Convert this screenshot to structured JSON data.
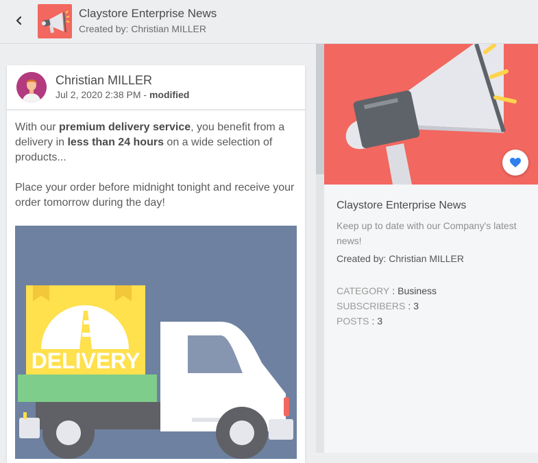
{
  "header": {
    "title": "Claystore Enterprise News",
    "subtitle": "Created by: Christian MILLER",
    "back_icon": "chevron-left-icon",
    "thumb_icon": "megaphone-icon"
  },
  "post": {
    "author": "Christian MILLER",
    "date": "Jul 2, 2020 2:38 PM",
    "date_separator": " - ",
    "modified": "modified",
    "p1": {
      "t1": "With our ",
      "b1": "premium delivery service",
      "t2": ", you benefit from a delivery in ",
      "b2": "less than 24 hours",
      "t3": " on a wide selection of products..."
    },
    "p2": "Place your order before midnight tonight and receive your order tomorrow during the day!",
    "image": {
      "label": "DELIVERY",
      "icon": "delivery-truck-illustration"
    }
  },
  "channel": {
    "title": "Claystore Enterprise News",
    "description": "Keep up to date with our Company's latest news!",
    "created_by": "Created by: Christian MILLER",
    "favorite_icon": "heart-icon",
    "stats": [
      {
        "key": "CATEGORY",
        "value": "Business"
      },
      {
        "key": "SUBSCRIBERS",
        "value": "3"
      },
      {
        "key": "POSTS",
        "value": "3"
      }
    ],
    "separator": ":"
  },
  "colors": {
    "accent_red": "#f2675f",
    "heart_blue": "#2f80ed",
    "truck_bg": "#6e81a0",
    "box_yellow": "#ffe04d",
    "flatbed_green": "#7fcd8a"
  }
}
